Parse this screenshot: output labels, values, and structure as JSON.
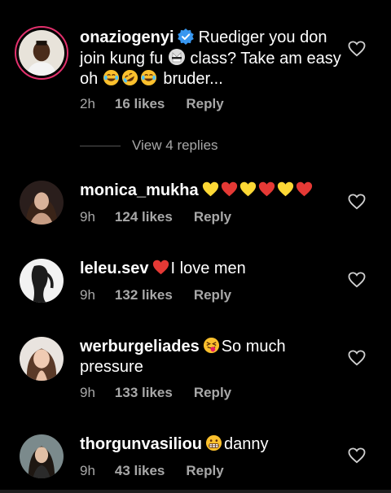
{
  "comments": [
    {
      "username": "onaziogenyi",
      "text_a": "Ruediger you don join kung fu",
      "text_b": "class?  Take am easy oh",
      "text_c": "bruder...",
      "time": "2h",
      "likes": "16 likes",
      "reply": "Reply",
      "view_replies": "View 4 replies"
    },
    {
      "username": "monica_mukha",
      "time": "9h",
      "likes": "124 likes",
      "reply": "Reply"
    },
    {
      "username": "leleu.sev",
      "text": "I love men",
      "time": "9h",
      "likes": "132 likes",
      "reply": "Reply"
    },
    {
      "username": "werburgeliades",
      "text": "So much pressure",
      "time": "9h",
      "likes": "133 likes",
      "reply": "Reply"
    },
    {
      "username": "thorgunvasiliou",
      "text": "danny",
      "time": "9h",
      "likes": "43 likes",
      "reply": "Reply"
    }
  ],
  "icons": {
    "like": "heart-outline-icon",
    "verified": "verified-badge-icon"
  },
  "colors": {
    "background": "#000000",
    "secondary_text": "#a8a8a8",
    "verified_blue": "#3897f0",
    "story_ring": "#e1306c"
  }
}
